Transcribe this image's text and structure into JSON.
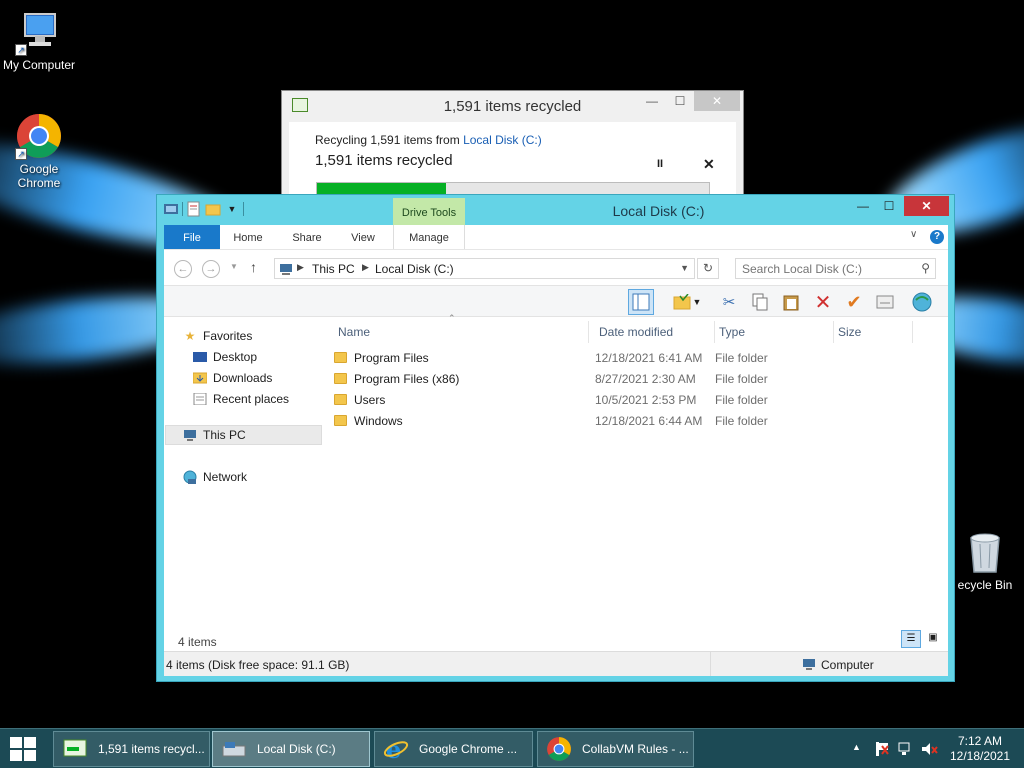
{
  "desktop": {
    "icons": [
      {
        "label": "My Computer"
      },
      {
        "label": "Google Chrome"
      },
      {
        "label": "ecycle Bin"
      }
    ]
  },
  "progress_dialog": {
    "title": "1,591 items recycled",
    "line1_prefix": "Recycling 1,591 items from ",
    "line1_source": "Local Disk (C:)",
    "status": "1,591 items recycled",
    "pause_glyph": "II",
    "close_glyph": "✕",
    "progress_fraction": 0.33,
    "min_glyph": "—",
    "max_glyph": "☐",
    "x_glyph": "✕"
  },
  "explorer": {
    "title": "Local Disk (C:)",
    "contextual_tab": "Drive Tools",
    "tabs": [
      "File",
      "Home",
      "Share",
      "View",
      "Manage"
    ],
    "address": {
      "crumbs": [
        "This PC",
        "Local Disk (C:)"
      ]
    },
    "search_placeholder": "Search Local Disk (C:)",
    "nav": {
      "favorites": "Favorites",
      "desktop": "Desktop",
      "downloads": "Downloads",
      "recent": "Recent places",
      "this_pc": "This PC",
      "network": "Network"
    },
    "columns": [
      "Name",
      "Date modified",
      "Type",
      "Size"
    ],
    "files": [
      {
        "name": "Program Files",
        "date": "12/18/2021 6:41 AM",
        "type": "File folder"
      },
      {
        "name": "Program Files (x86)",
        "date": "8/27/2021 2:30 AM",
        "type": "File folder"
      },
      {
        "name": "Users",
        "date": "10/5/2021 2:53 PM",
        "type": "File folder"
      },
      {
        "name": "Windows",
        "date": "12/18/2021 6:44 AM",
        "type": "File folder"
      }
    ],
    "items_count": "4 items",
    "status_left": "4 items (Disk free space: 91.1 GB)",
    "status_right": "Computer"
  },
  "taskbar": {
    "buttons": [
      {
        "label": "1,591 items recycl..."
      },
      {
        "label": "Local Disk (C:)"
      },
      {
        "label": "Google Chrome ..."
      },
      {
        "label": "CollabVM Rules - ..."
      }
    ],
    "time": "7:12 AM",
    "date": "12/18/2021"
  },
  "colors": {
    "explorer_frame": "#64d3e6",
    "taskbar": "#1c4a55",
    "progress_fill": "#06b025",
    "file_tab": "#1979ca",
    "close_button": "#c8353a"
  }
}
